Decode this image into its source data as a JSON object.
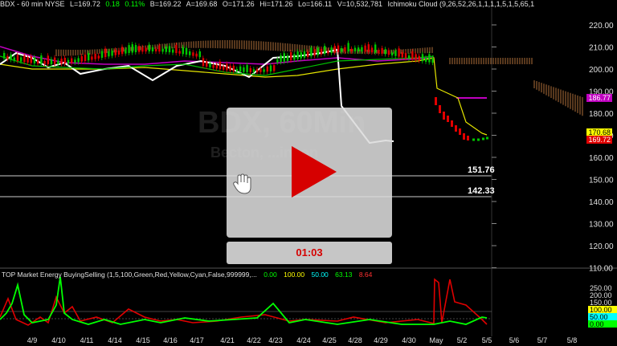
{
  "header": {
    "symbol": "BDX - 60 min  NYSE",
    "last": "L=169.72",
    "change": "0.18",
    "change_pct": "0.11%",
    "bid": "B=169.22",
    "ask": "A=169.68",
    "open": "O=171.26",
    "high": "Hi=171.26",
    "low": "Lo=166.11",
    "volume": "V=10,532,781",
    "study": "Ichimoku Cloud (9,26,52,26,1,1,1,1,5,1,5,65,1"
  },
  "watermark": {
    "ticker": "BDX, 60Min",
    "name": "Becton, ...inson"
  },
  "price_axis": {
    "ticks": [
      "220.00",
      "210.00",
      "200.00",
      "190.00",
      "180.00",
      "170.00",
      "160.00",
      "150.00",
      "140.00",
      "130.00",
      "120.00",
      "110.00"
    ]
  },
  "price_tags": {
    "cloud": "186.77",
    "upper": "170.68",
    "last": "169.72"
  },
  "levels": [
    {
      "label": "151.76"
    },
    {
      "label": "142.33"
    }
  ],
  "indicator": {
    "title": "TOP Market Energy BuyingSelling (1,5,100,Green,Red,Yellow,Cyan,False,999999,...",
    "v1": "0.00",
    "v2": "100.00",
    "v3": "50.00",
    "v4": "63.13",
    "v5": "8.64",
    "axis_ticks": [
      "250.00",
      "200.00",
      "150.00",
      "100.00",
      "50.00",
      "0.00"
    ]
  },
  "x_axis": {
    "labels": [
      "4/9",
      "4/10",
      "4/11",
      "4/14",
      "4/15",
      "4/16",
      "4/17",
      "4/21",
      "4/22",
      "4/23",
      "4/24",
      "4/25",
      "4/28",
      "4/29",
      "4/30",
      "May",
      "5/2",
      "5/5",
      "5/6",
      "5/7",
      "5/8"
    ]
  },
  "video": {
    "time": "01:03"
  },
  "colors": {
    "up": "#00c800",
    "down": "#e00000",
    "accent_red": "#e00000",
    "green": "#00ff00",
    "yellow": "#ffff00",
    "cyan": "#00ffff"
  },
  "icons": [
    "play-icon",
    "hand-cursor-icon"
  ]
}
